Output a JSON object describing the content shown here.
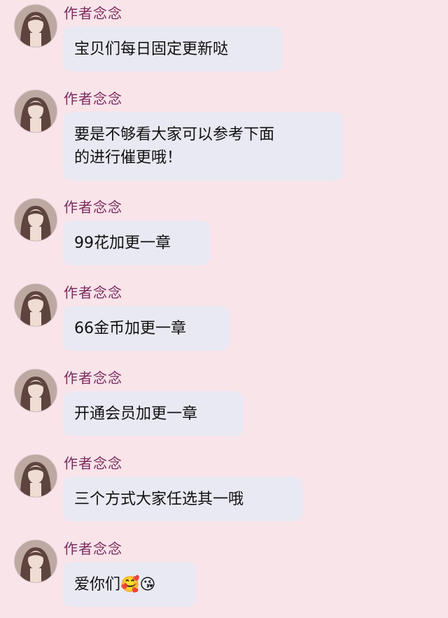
{
  "messages": [
    {
      "sender": "作者念念",
      "text": "宝贝们每日固定更新哒"
    },
    {
      "sender": "作者念念",
      "text": "要是不够看大家可以参考下面\n的进行催更哦！"
    },
    {
      "sender": "作者念念",
      "text": "99花加更一章"
    },
    {
      "sender": "作者念念",
      "text": "66金币加更一章"
    },
    {
      "sender": "作者念念",
      "text": "开通会员加更一章"
    },
    {
      "sender": "作者念念",
      "text": "三个方式大家任选其一哦"
    },
    {
      "sender": "作者念念",
      "text": "爱你们🥰😘"
    }
  ]
}
